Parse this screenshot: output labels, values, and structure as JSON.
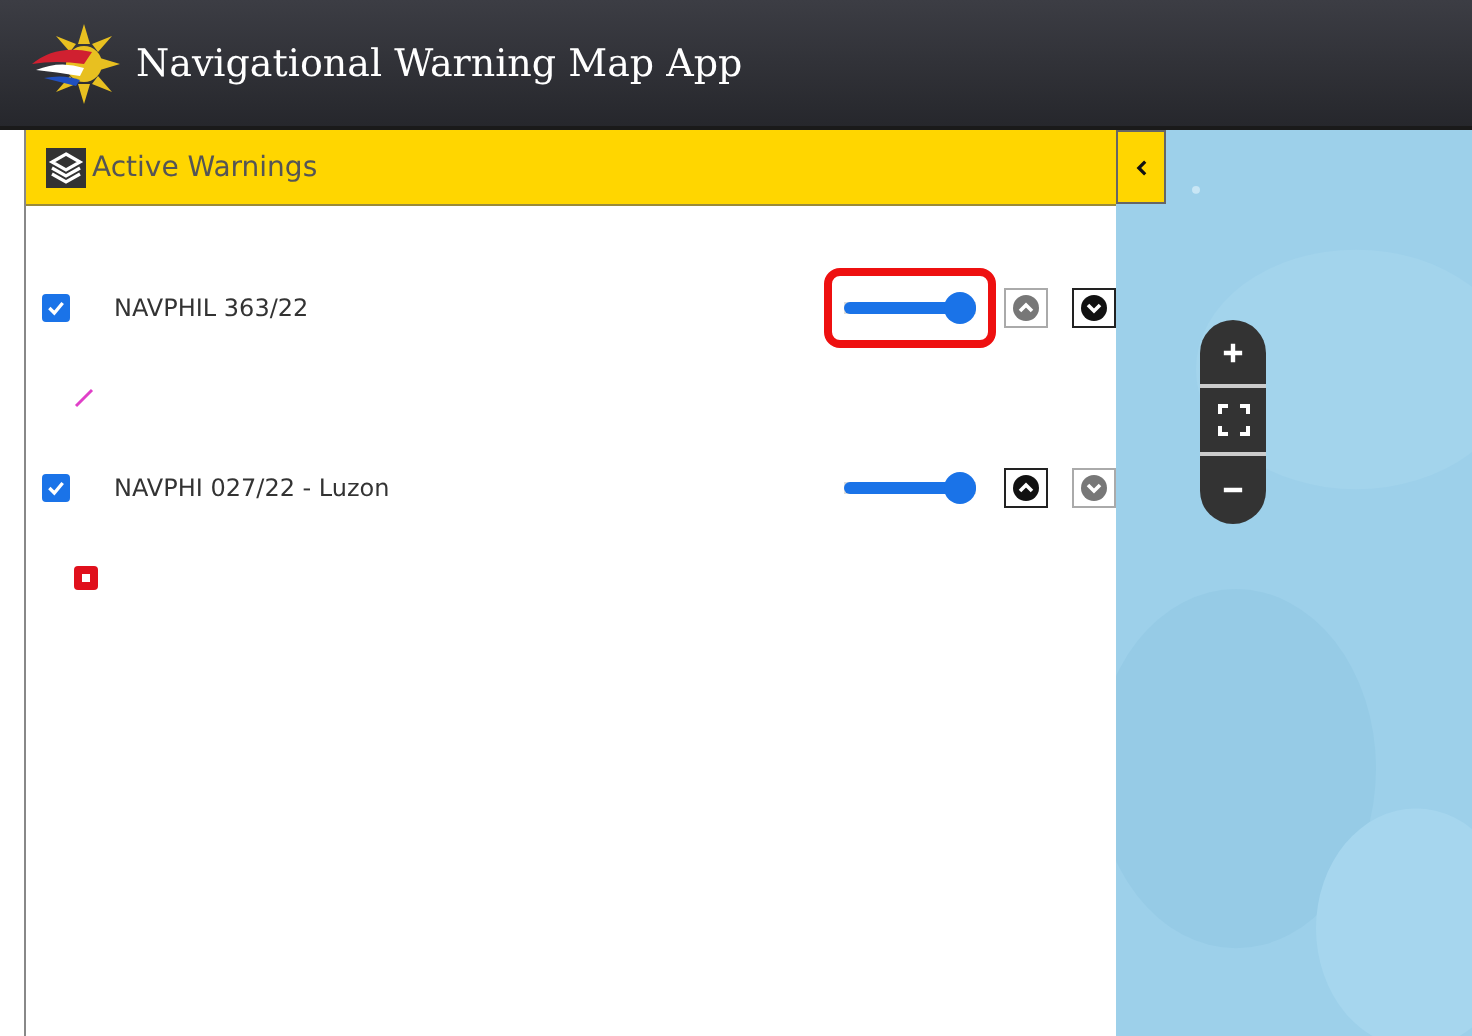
{
  "app": {
    "title": "Navigational Warning Map App"
  },
  "panel": {
    "title": "Active Warnings"
  },
  "layers": [
    {
      "name": "NAVPHIL 363/22",
      "checked": true,
      "level": 1,
      "highlighted": true,
      "up_disabled": true,
      "down_disabled": false,
      "symbol": {
        "kind": "line",
        "color": "#e040c8"
      }
    },
    {
      "name": "NAVPHI 027/22 - Luzon",
      "checked": true,
      "level": 1,
      "highlighted": false,
      "up_disabled": false,
      "down_disabled": true,
      "symbol": {
        "kind": "square",
        "color": "#e0101c"
      }
    }
  ]
}
